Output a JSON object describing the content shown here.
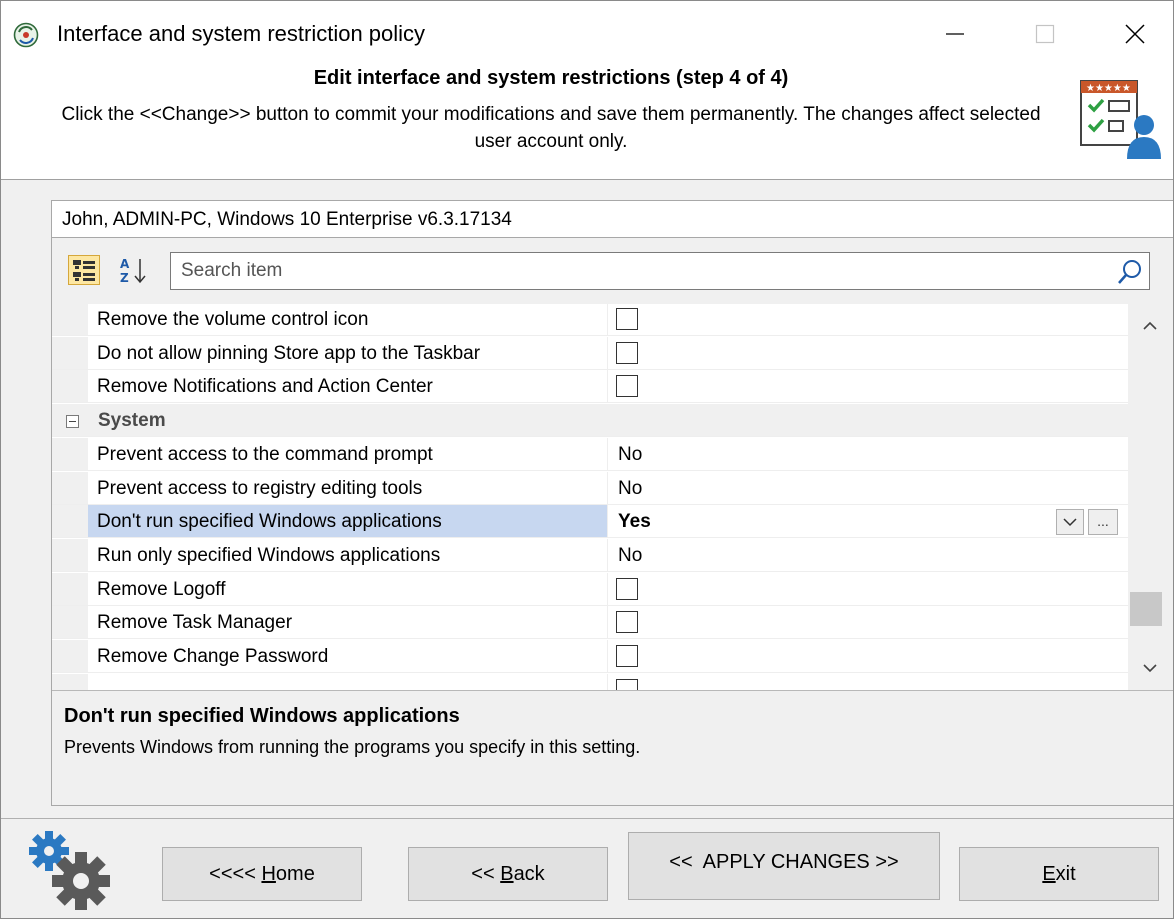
{
  "window": {
    "title": "Interface and system restriction policy"
  },
  "header": {
    "step_title": "Edit interface and system restrictions (step 4 of 4)",
    "description": "Click the <<Change>> button to commit your modifications and save them permanently. The changes affect selected user account only."
  },
  "account": {
    "line": "John, ADMIN-PC, Windows 10 Enterprise  v6.3.17134"
  },
  "search": {
    "placeholder": "Search item",
    "value": ""
  },
  "grid": {
    "rows": [
      {
        "type": "item",
        "name": "Remove the volume control icon",
        "value_kind": "checkbox",
        "checked": false
      },
      {
        "type": "item",
        "name": "Do not allow pinning Store app to the Taskbar",
        "value_kind": "checkbox",
        "checked": false
      },
      {
        "type": "item",
        "name": "Remove Notifications and Action Center",
        "value_kind": "checkbox",
        "checked": false
      },
      {
        "type": "category",
        "name": "System",
        "expanded": true
      },
      {
        "type": "item",
        "name": "Prevent access to the command prompt",
        "value_kind": "text",
        "value": "No"
      },
      {
        "type": "item",
        "name": "Prevent access to registry editing tools",
        "value_kind": "text",
        "value": "No"
      },
      {
        "type": "item",
        "name": "Don't run specified Windows applications",
        "value_kind": "text",
        "value": "Yes",
        "selected": true,
        "dropdown_button": "∨",
        "ellipsis_button": "..."
      },
      {
        "type": "item",
        "name": "Run only specified Windows applications",
        "value_kind": "text",
        "value": "No"
      },
      {
        "type": "item",
        "name": "Remove Logoff",
        "value_kind": "checkbox",
        "checked": false
      },
      {
        "type": "item",
        "name": "Remove Task Manager",
        "value_kind": "checkbox",
        "checked": false
      },
      {
        "type": "item",
        "name": "Remove Change Password",
        "value_kind": "checkbox",
        "checked": false
      }
    ],
    "scroll_position": 0.78
  },
  "description_panel": {
    "title": "Don't run specified Windows applications",
    "text": "Prevents Windows from running the programs you specify in this setting."
  },
  "footer": {
    "home_prefix": "<<<< ",
    "home_mnemonic": "H",
    "home_rest": "ome",
    "back_prefix": "<< ",
    "back_mnemonic": "B",
    "back_rest": "ack",
    "apply_label": "<<  APPLY CHANGES >>",
    "exit_mnemonic": "E",
    "exit_rest": "xit"
  },
  "icons": {
    "app": "policy-app-icon",
    "header": "checklist-user-icon",
    "categorized": "categorized-view-icon",
    "alphabetical": "sort-az-icon",
    "search": "search-icon",
    "footer": "gears-icon"
  },
  "colors": {
    "selected_row": "#c7d7f0",
    "category_text": "#4a4a4a",
    "categorized_button": "#fde7a2"
  }
}
